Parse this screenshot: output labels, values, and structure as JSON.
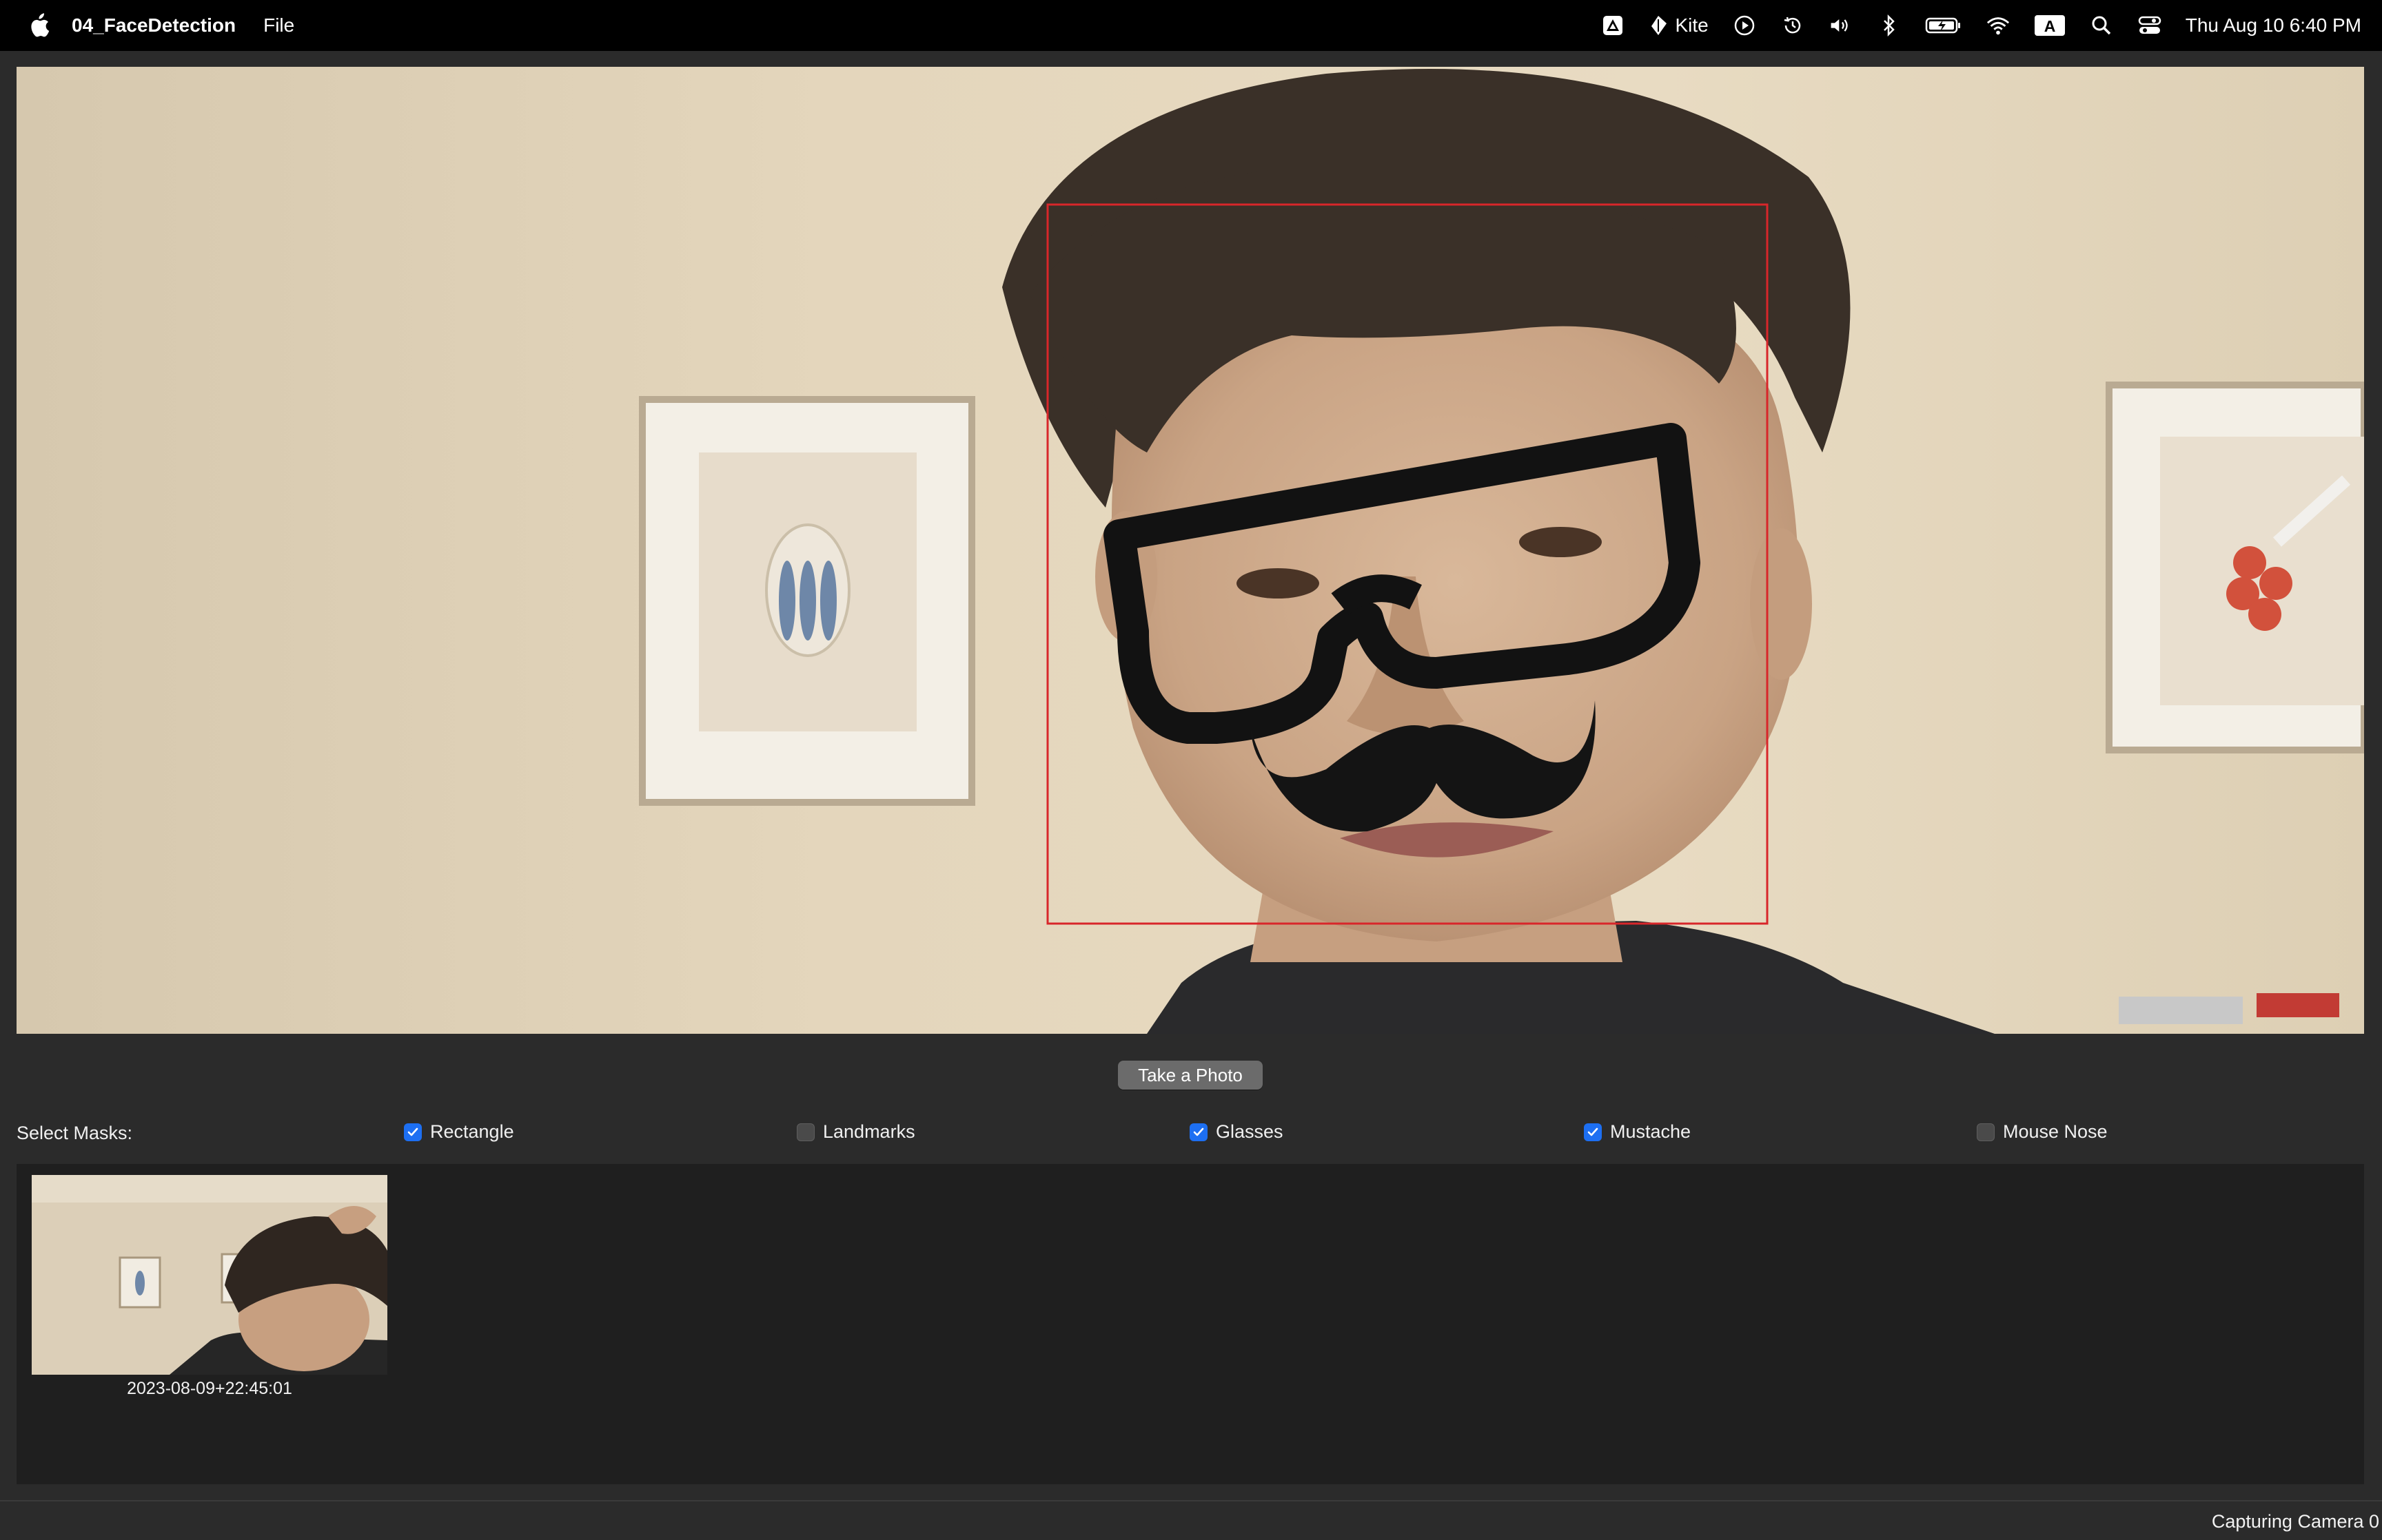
{
  "menubar": {
    "app_name": "04_FaceDetection",
    "menus": [
      "File"
    ],
    "kite_label": "Kite",
    "clock": "Thu Aug 10  6:40 PM",
    "icons": [
      "apple-icon",
      "adobe-icon",
      "kite-icon",
      "play-icon",
      "time-machine-icon",
      "volume-icon",
      "bluetooth-icon",
      "battery-icon",
      "wifi-icon",
      "input-source-icon",
      "spotlight-icon",
      "control-center-icon"
    ]
  },
  "camera": {
    "face_box_color": "#d8262a",
    "overlays": [
      "rectangle",
      "glasses",
      "mustache"
    ]
  },
  "controls": {
    "take_photo_label": "Take a Photo",
    "select_masks_label": "Select Masks:",
    "masks": [
      {
        "label": "Rectangle",
        "checked": true
      },
      {
        "label": "Landmarks",
        "checked": false
      },
      {
        "label": "Glasses",
        "checked": true
      },
      {
        "label": "Mustache",
        "checked": true
      },
      {
        "label": "Mouse Nose",
        "checked": false
      }
    ]
  },
  "gallery": {
    "items": [
      {
        "caption": "2023-08-09+22:45:01"
      }
    ]
  },
  "status": {
    "text": "Capturing Camera 0"
  },
  "colors": {
    "accent": "#1d6ff2",
    "window_bg": "#2b2b2b",
    "gallery_bg": "#1f1f1f"
  }
}
